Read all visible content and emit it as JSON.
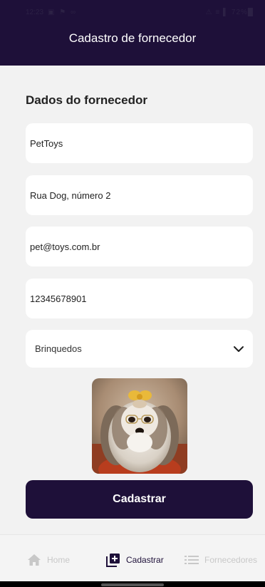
{
  "status_bar": {
    "time": "12:23",
    "left_icons": "▣ ⚑ ∞",
    "right": "⚠ ≡ ▌ 72%█"
  },
  "header": {
    "title": "Cadastro de fornecedor"
  },
  "form": {
    "section_title": "Dados do fornecedor",
    "fields": [
      {
        "value": "PetToys"
      },
      {
        "value": "Rua Dog, número 2"
      },
      {
        "value": "pet@toys.com.br"
      },
      {
        "value": "12345678901"
      }
    ],
    "category": {
      "selected": "Brinquedos"
    },
    "submit_label": "Cadastrar"
  },
  "bottom_nav": {
    "items": [
      {
        "label": "Home",
        "icon": "home-icon",
        "active": false
      },
      {
        "label": "Cadastrar",
        "icon": "add-box-icon",
        "active": true
      },
      {
        "label": "Fornecedores",
        "icon": "list-icon",
        "active": false
      }
    ]
  },
  "colors": {
    "primary": "#1e1039",
    "background": "#f2f2f2",
    "surface": "#ffffff",
    "nav_inactive": "#c8c8c8"
  }
}
